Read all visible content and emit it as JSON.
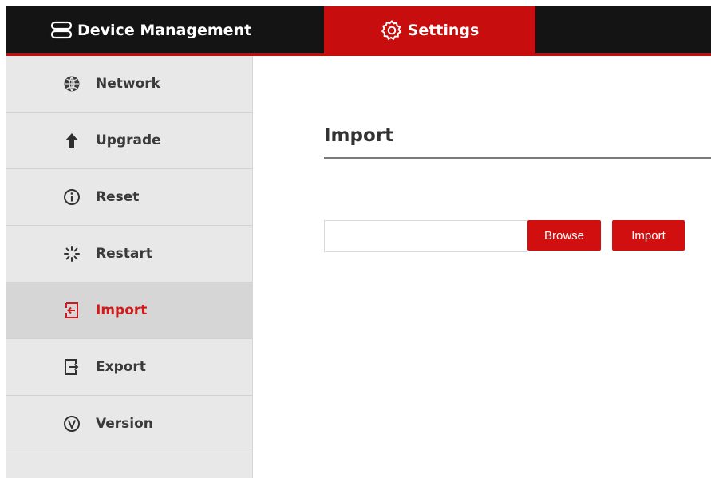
{
  "topbar": {
    "device_management": {
      "label": "Device Management",
      "icon": "server-icon"
    },
    "settings": {
      "label": "Settings",
      "icon": "gear-icon"
    }
  },
  "sidebar": {
    "items": [
      {
        "label": "Network",
        "icon": "network-icon",
        "active": false
      },
      {
        "label": "Upgrade",
        "icon": "arrow-up-icon",
        "active": false
      },
      {
        "label": "Reset",
        "icon": "info-icon",
        "active": false
      },
      {
        "label": "Restart",
        "icon": "spinner-icon",
        "active": false
      },
      {
        "label": "Import",
        "icon": "import-icon",
        "active": true
      },
      {
        "label": "Export",
        "icon": "export-icon",
        "active": false
      },
      {
        "label": "Version",
        "icon": "version-icon",
        "active": false
      }
    ]
  },
  "content": {
    "title": "Import",
    "file_input": {
      "value": "",
      "placeholder": ""
    },
    "browse_label": "Browse",
    "import_label": "Import"
  },
  "colors": {
    "accent": "#c70d0d",
    "topbar": "#141414",
    "sidebar": "#e8e8e9",
    "sidebar_active": "#d6d6d7",
    "active_text": "#d21a1a"
  }
}
